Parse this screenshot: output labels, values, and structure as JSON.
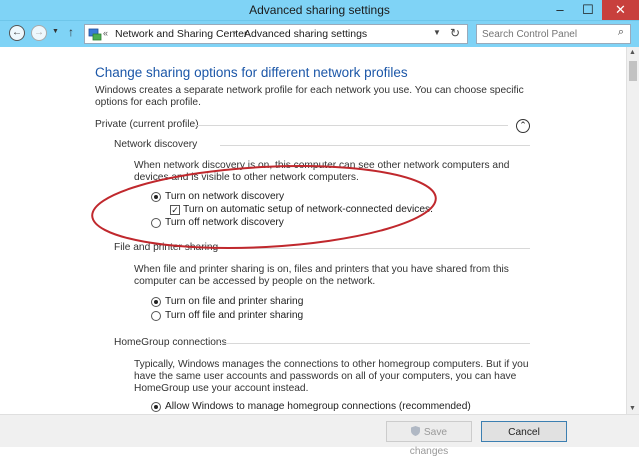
{
  "window": {
    "title": "Advanced sharing settings",
    "min_glyph": "–",
    "max_glyph": "☐",
    "close_glyph": "✕"
  },
  "address": {
    "root_sep": "«",
    "crumbs": [
      "Network and Sharing Center",
      "Advanced sharing settings"
    ],
    "crumb_sep": "›",
    "search_placeholder": "Search Control Panel"
  },
  "nav": {
    "back_glyph": "←",
    "forward_glyph": "→",
    "dropdown_glyph": "▼",
    "up_glyph": "↑",
    "refresh_glyph": "↻",
    "search_glyph": "⌕"
  },
  "main": {
    "heading": "Change sharing options for different network profiles",
    "intro": "Windows creates a separate network profile for each network you use. You can choose specific options for each profile.",
    "profile_label": "Private (current profile)",
    "collapse_glyph": "⌃",
    "sections": [
      {
        "label": "Network discovery",
        "description": "When network discovery is on, this computer can see other network computers and devices and is visible to other network computers.",
        "options": [
          {
            "label": "Turn on network discovery",
            "selected": true
          },
          {
            "label": "Turn on automatic setup of network-connected devices.",
            "checked": true,
            "type": "checkbox"
          },
          {
            "label": "Turn off network discovery",
            "selected": false
          }
        ]
      },
      {
        "label": "File and printer sharing",
        "description": "When file and printer sharing is on, files and printers that you have shared from this computer can be accessed by people on the network.",
        "options": [
          {
            "label": "Turn on file and printer sharing",
            "selected": true
          },
          {
            "label": "Turn off file and printer sharing",
            "selected": false
          }
        ]
      },
      {
        "label": "HomeGroup connections",
        "description": "Typically, Windows manages the connections to other homegroup computers. But if you have the same user accounts and passwords on all of your computers, you can have HomeGroup use your account instead.",
        "options": [
          {
            "label": "Allow Windows to manage homegroup connections (recommended)",
            "selected": true
          }
        ]
      }
    ]
  },
  "footer": {
    "save_label": "Save changes",
    "cancel_label": "Cancel"
  },
  "colors": {
    "titlebar": "#7fd3f6",
    "heading": "#1c57a8",
    "annotation": "#c0282d"
  }
}
